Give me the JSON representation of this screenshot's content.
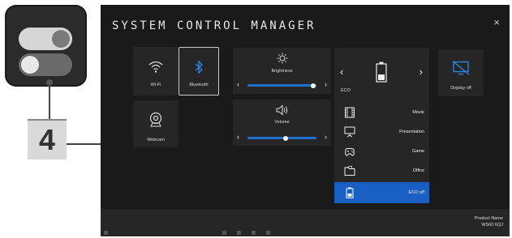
{
  "callout": {
    "number": "4"
  },
  "window": {
    "title": "SYSTEM CONTROL MANAGER",
    "close": "×"
  },
  "tiles": {
    "wifi": "Wi-Fi",
    "bluetooth": "Bluetooth",
    "webcam": "Webcam",
    "brightness": "Brightness",
    "volume": "Volume",
    "display": "Display off"
  },
  "brightness_level": 0.95,
  "volume_level": 0.55,
  "eco": {
    "label": "ECO",
    "modes": [
      "Movie",
      "Presentation",
      "Game",
      "Office",
      "ECO off"
    ],
    "active": "ECO off"
  },
  "product": {
    "name_label": "Product Name",
    "model": "WS60 6QJ"
  },
  "colors": {
    "accent": "#1a5fc4",
    "bluetooth": "#2c8ae8"
  }
}
